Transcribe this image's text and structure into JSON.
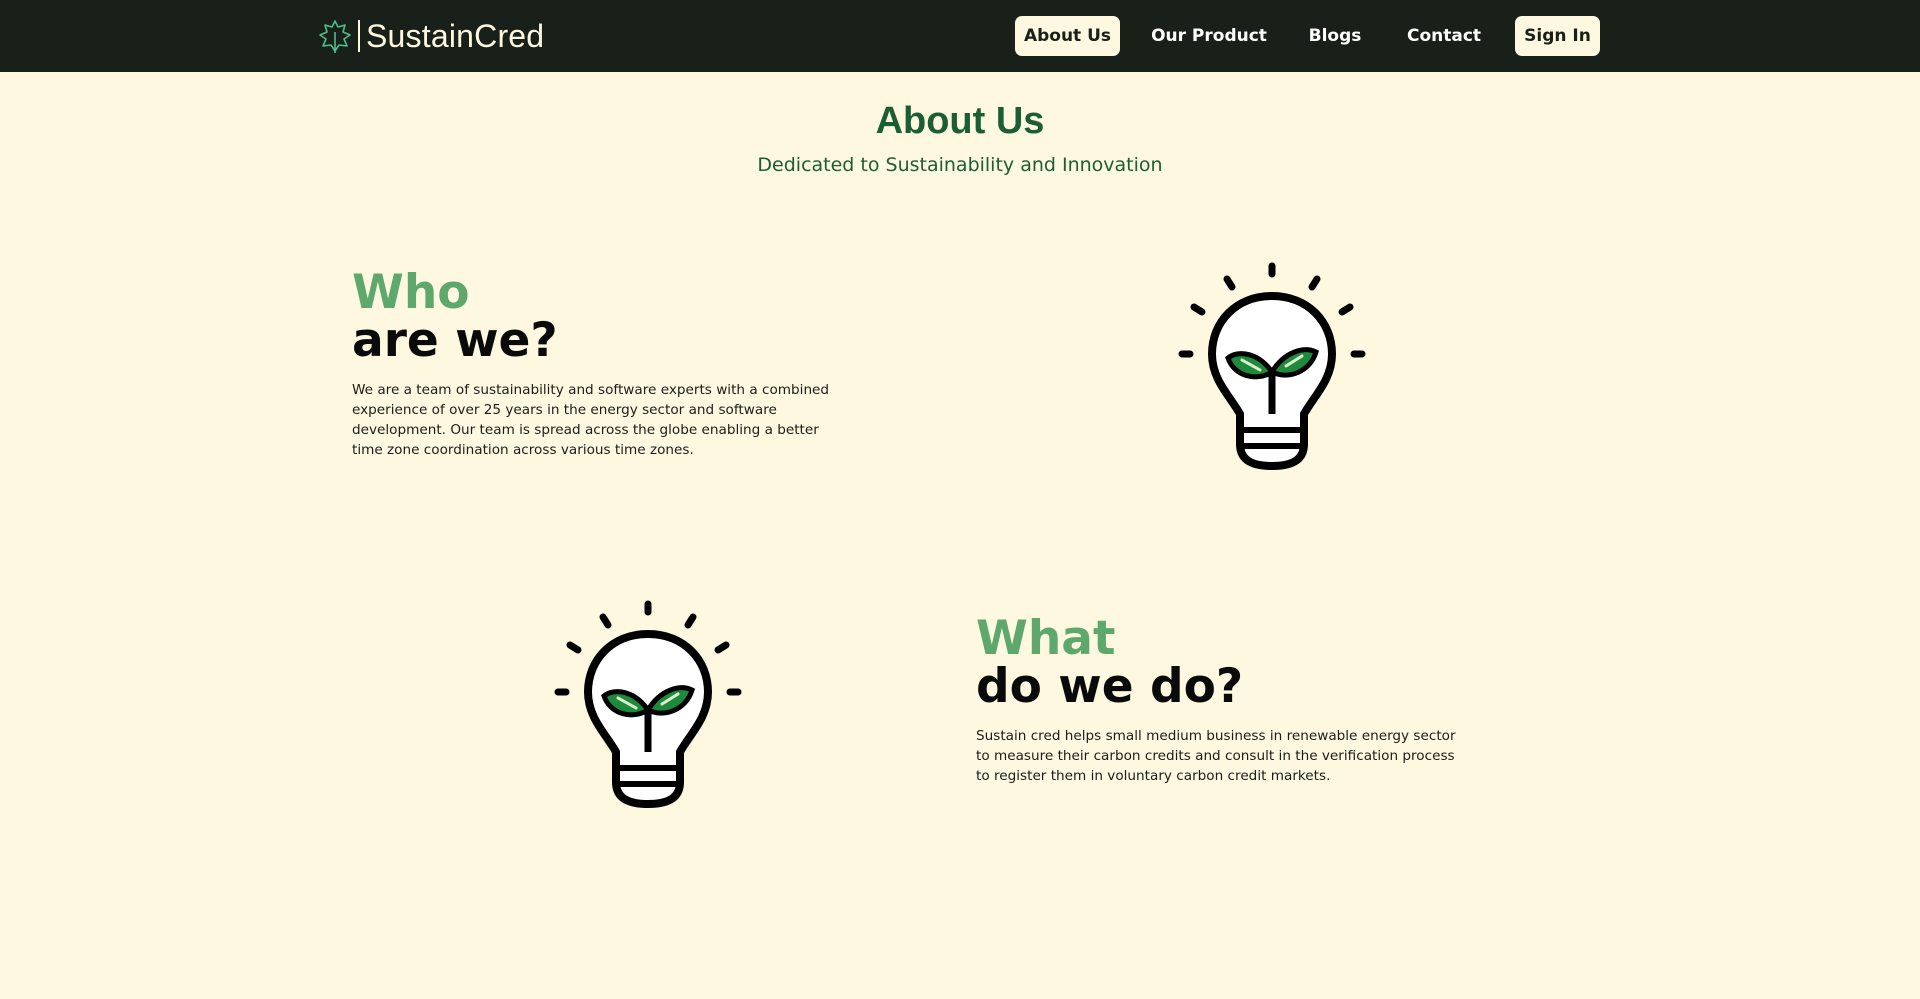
{
  "brand": {
    "name": "SustainCred",
    "logo_icon": "leaf-outline-icon"
  },
  "nav": {
    "about": "About Us",
    "product": "Our Product",
    "blogs": "Blogs",
    "contact": "Contact",
    "signin": "Sign In"
  },
  "hero": {
    "title": "About Us",
    "subtitle": "Dedicated to Sustainability and Innovation"
  },
  "who": {
    "title_green": "Who",
    "title_dark": "are we?",
    "body": "We are a team of sustainability and software experts with a combined experience of over 25 years in the energy sector and software development. Our team is spread across the globe enabling a better time zone coordination across various time zones.",
    "icon": "lightbulb-sprout-icon"
  },
  "what": {
    "title_green": "What",
    "title_dark": "do we do?",
    "body": "Sustain cred helps small medium business in renewable energy sector to measure their carbon credits and consult in the verification process to register them in voluntary carbon credit markets.",
    "icon": "lightbulb-sprout-icon"
  },
  "colors": {
    "navbar": "#19201a",
    "background": "#fdf8df",
    "accent_dark_green": "#1c5e33",
    "accent_light_green": "#5ea86e",
    "leaf_green": "#1f8a3c"
  }
}
